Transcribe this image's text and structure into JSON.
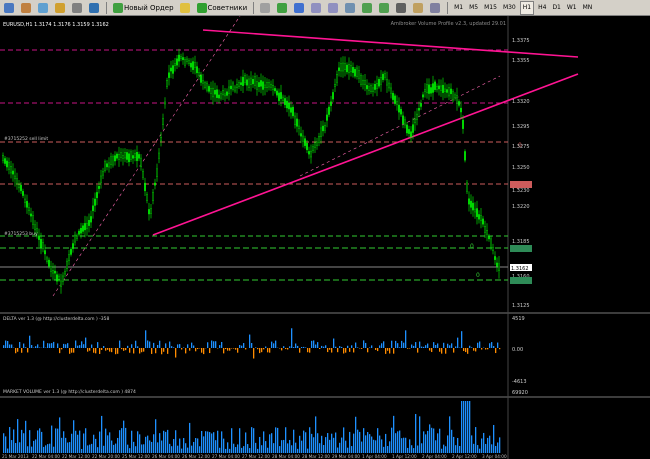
{
  "toolbar": {
    "new_order_label": "Новый Ордер",
    "advisors_label": "Советники",
    "timeframes": [
      "M1",
      "M5",
      "M15",
      "M30",
      "H1",
      "H4",
      "D1",
      "W1",
      "MN"
    ],
    "active_timeframe": "H1"
  },
  "chart": {
    "symbol_header": "EURUSD,H1  1.3174 1.3176 1.3159 1.3162",
    "indicator_note": "Amibroker Volume Profile v2.3, updated 29.01",
    "order_sell": "#3715252 sell limit",
    "order_buy": "#3715253 buy",
    "price_labels": [
      "1.3375",
      "1.3355",
      "1.3320",
      "1.3295",
      "1.3275",
      "1.3250",
      "1.3230",
      "1.3220",
      "1.3185",
      "1.3160",
      "1.3125"
    ],
    "last_price": "1.3162",
    "delta_title": "DELTA ver 1.3 (@ http://clusterdelta.com ) -358",
    "delta_scale": [
      "4519",
      "0.00",
      "-4613"
    ],
    "volume_title": "MARKET VOLUME ver 1.3 (@ http://clusterdelta.com ) 4874",
    "volume_scale": "69920",
    "time_labels": [
      "21 Mar 2013",
      "22 Mar 04:00",
      "22 Mar 12:00",
      "22 Mar 20:00",
      "25 Mar 12:00",
      "26 Mar 04:00",
      "26 Mar 12:00",
      "27 Mar 04:00",
      "27 Mar 12:00",
      "28 Mar 04:00",
      "28 Mar 12:00",
      "29 Mar 04:00",
      "1 Apr 04:00",
      "1 Apr 12:00",
      "2 Apr 04:00",
      "2 Apr 12:00",
      "3 Apr 04:00"
    ]
  },
  "colors": {
    "candle": "#00ff00",
    "trendline": "#ff1493",
    "delta_positive": "#1e90ff",
    "delta_negative": "#ff8c00",
    "volume": "#1e90ff"
  }
}
